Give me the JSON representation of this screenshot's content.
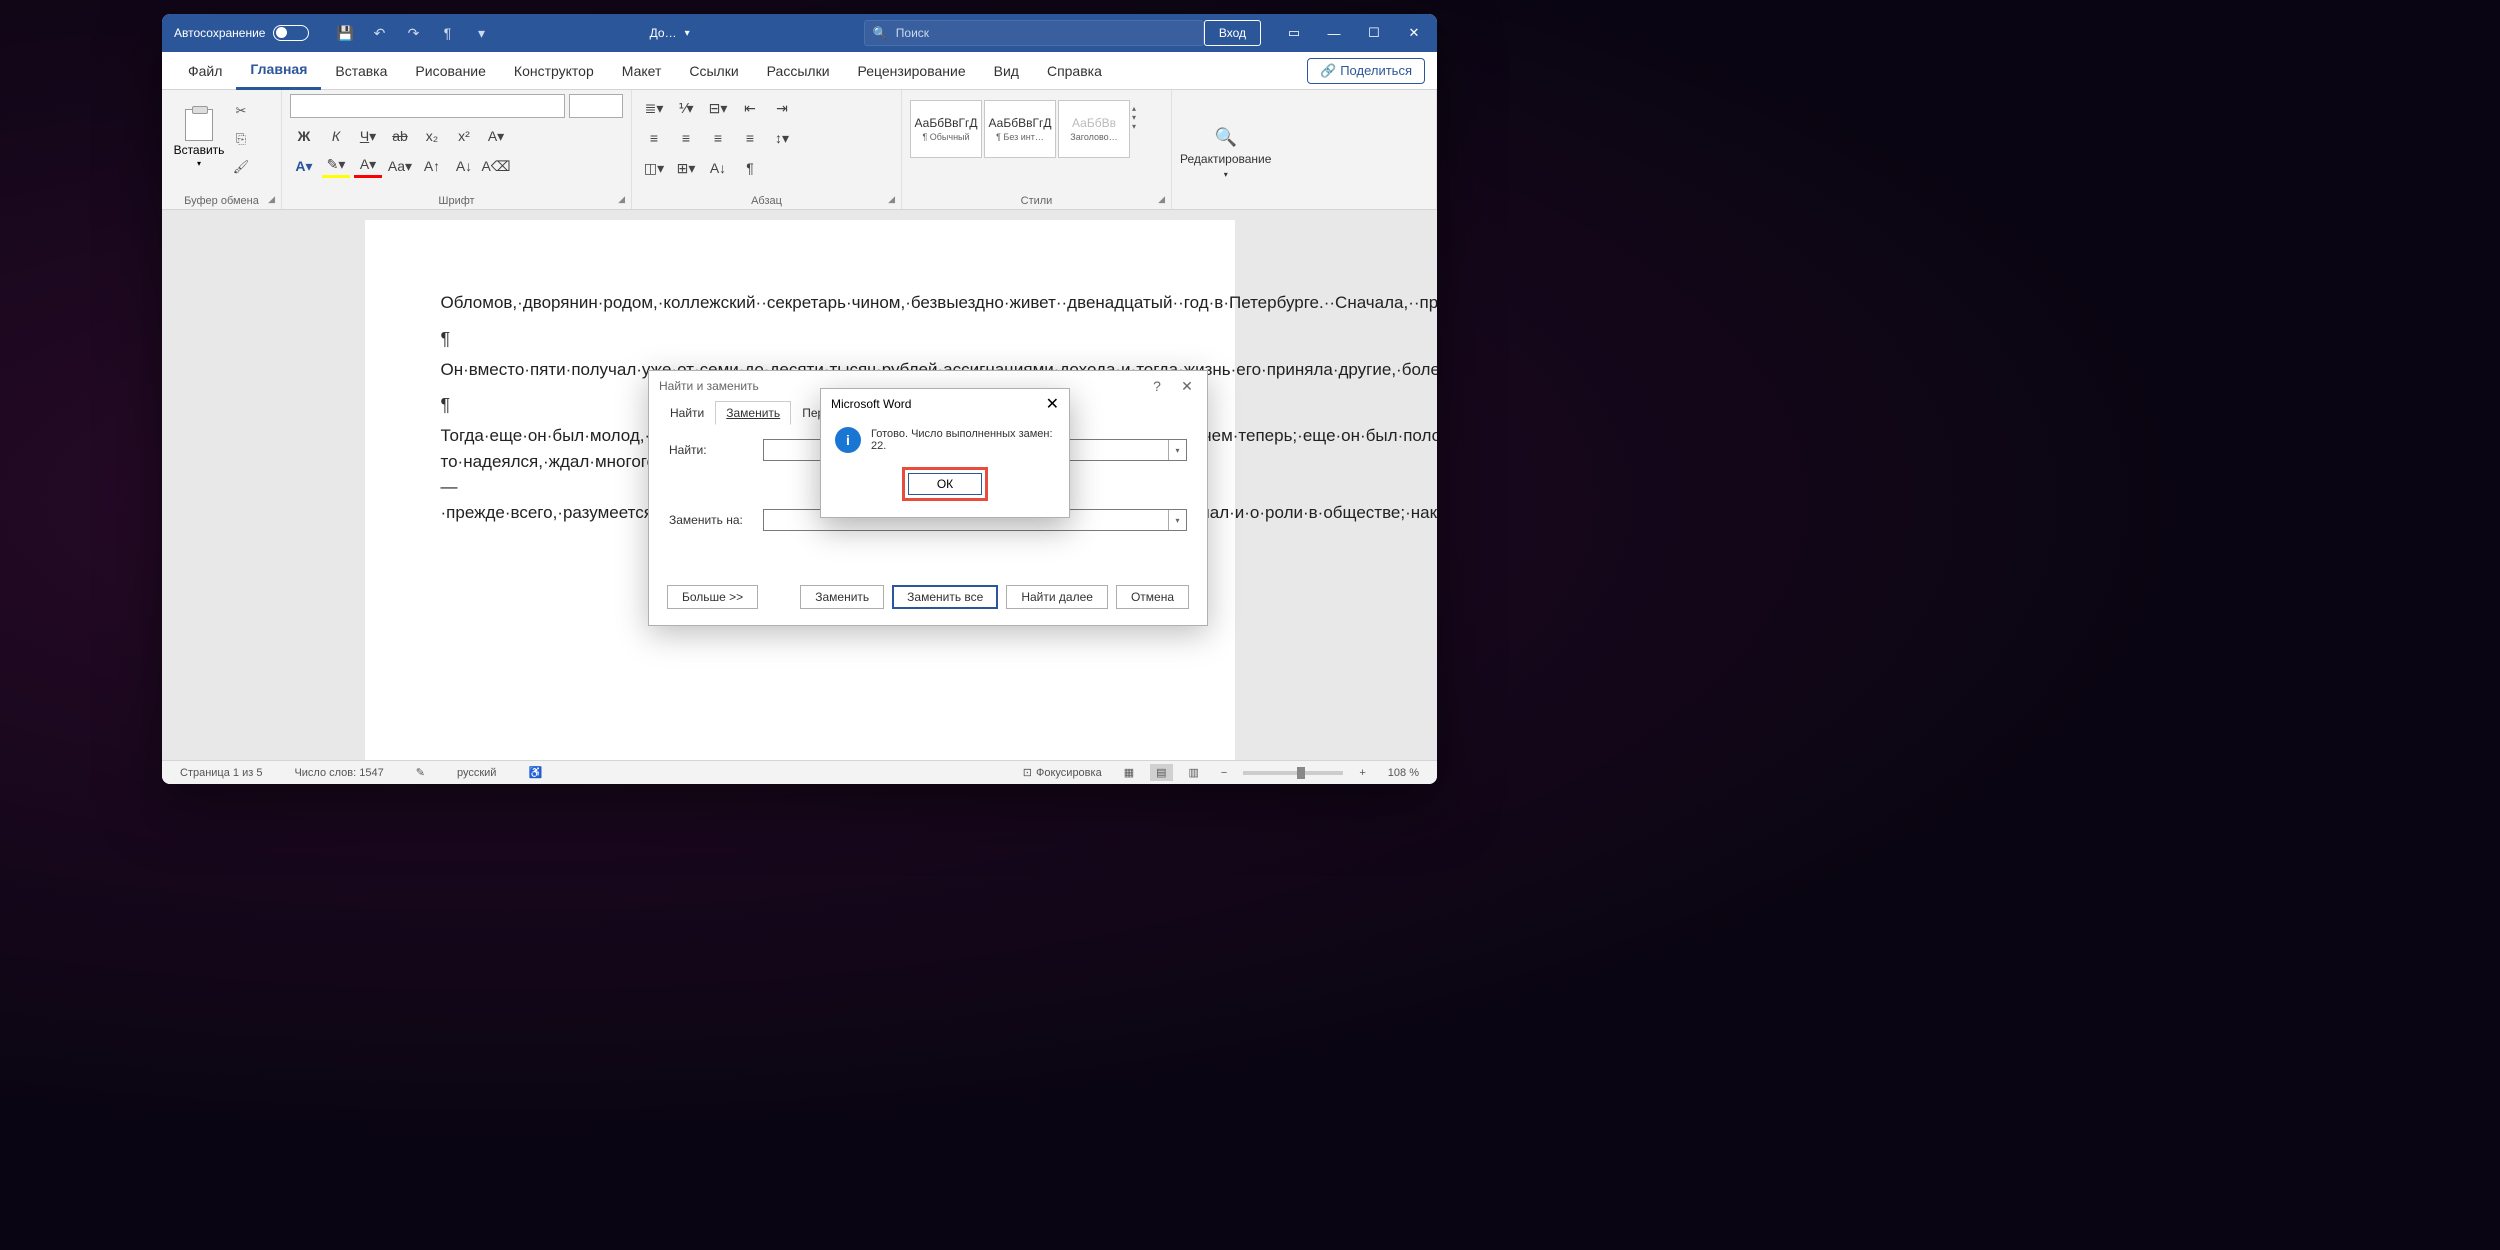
{
  "titlebar": {
    "autosave": "Автосохранение",
    "doc_title": "До…",
    "search_placeholder": "Поиск",
    "login": "Вход"
  },
  "tabs": {
    "file": "Файл",
    "home": "Главная",
    "insert": "Вставка",
    "draw": "Рисование",
    "design": "Конструктор",
    "layout": "Макет",
    "references": "Ссылки",
    "mailings": "Рассылки",
    "review": "Рецензирование",
    "view": "Вид",
    "help": "Справка",
    "share": "Поделиться"
  },
  "ribbon": {
    "clipboard": {
      "label": "Буфер обмена",
      "paste": "Вставить"
    },
    "font": {
      "label": "Шрифт"
    },
    "paragraph": {
      "label": "Абзац"
    },
    "styles": {
      "label": "Стили",
      "items": [
        {
          "sample": "АаБбВвГгД",
          "name": "¶ Обычный"
        },
        {
          "sample": "АаБбВвГгД",
          "name": "¶ Без инт…"
        },
        {
          "sample": "АаБбВв",
          "name": "Заголово…"
        }
      ]
    },
    "editing": {
      "label": "Редактирование"
    }
  },
  "document": {
    "p1": "Обломов,·дворянин·родом,·коллежский··секретарь·чином,·безвыездно·живет··двенадцатый··год·в·Петербурге.··Сначала,··при··жизни··родителей,··жил··потеснее,··помещался··в···двух···комнатах,·довольствовался·только·вывезенным·им·из·деревни·слугой·Захаром;·но·по·смерти·отца·и·матери·он·стал·единственным·обладателем·трехсот·пятидесяти·душ,·доставшихся·ему·в·наследство·в·одной·из·отдаленных·губерний·чуть·не·в·Азии.¶",
    "p2": "Он·вместо·пяти·получал·уже·от·семи·до·десяти·тысяч·рублей·ассигнациями·дохода·и·тогда·жизнь·его·приняла·другие,·более·широкие·размеры.·нанял·квартиру·побольше,·прибавил·к·своему·штату·еще·повара·и·завел·было·пару·лошадей.¶",
    "p3": "Тогда·еще·он·был·молод,·и·если·нельзя·сказать,·чтоб·он·был·жив,·то·по·крайней·мере·живее,·чем·теперь;·еще·он·был·полон·разных·стремлений,·все·чего-то·надеялся,·ждал·многого·и·от·судьбы,·и·от·самого·себя;·все·готовился·к·поприщу,·к·роли·—·прежде·всего,·разумеется,·в·службе,·что·и·было·целью·его·приезда·в·Петербург.·Потом·он·думал·и·о·роли·в·обществе;·наконец,·в·отдаленной·перспективе,·на·повороте·с·юности·к·зрелым·летам,·воображению·его·мелькало·и·улыбалось·семейное·счастие.¶"
  },
  "statusbar": {
    "page": "Страница 1 из 5",
    "words": "Число слов: 1547",
    "lang": "русский",
    "focus": "Фокусировка",
    "zoom": "108 %"
  },
  "find_dialog": {
    "title": "Найти и заменить",
    "tab_find": "Найти",
    "tab_replace": "Заменить",
    "tab_goto": "Перейти",
    "find_label": "Найти:",
    "replace_label": "Заменить на:",
    "more": "Больше >>",
    "replace": "Заменить",
    "replace_all": "Заменить все",
    "find_next": "Найти далее",
    "cancel": "Отмена"
  },
  "msg_dialog": {
    "title": "Microsoft Word",
    "message": "Готово. Число выполненных замен: 22.",
    "ok": "ОК"
  }
}
